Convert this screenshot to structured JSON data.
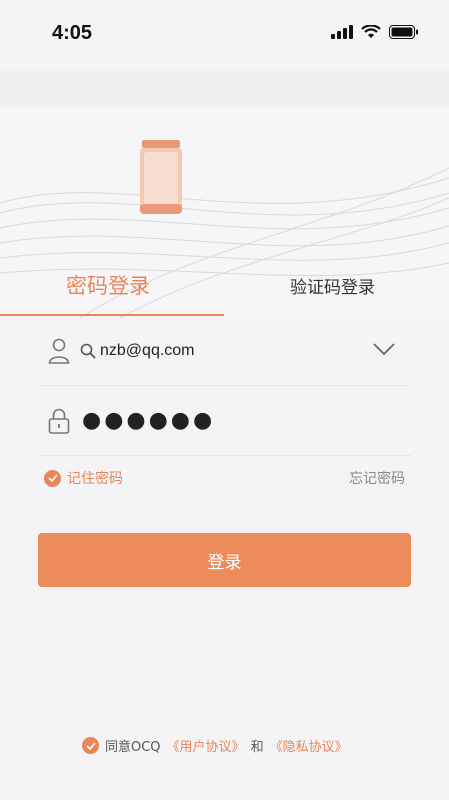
{
  "status_bar": {
    "time": "4:05"
  },
  "tabs": {
    "password_login": "密码登录",
    "code_login": "验证码登录"
  },
  "fields": {
    "email": "nzb@qq.com",
    "password_masked": "●●●●●●"
  },
  "options": {
    "remember": "记住密码",
    "forgot": "忘记密码"
  },
  "login_button": "登录",
  "agreement": {
    "prefix": "同意OCQ",
    "user_agreement": "《用户协议》",
    "and": "和",
    "privacy": "《隐私协议》"
  },
  "colors": {
    "accent": "#e8865a",
    "button": "#ee8b5b"
  },
  "icons": [
    "signal-icon",
    "wifi-icon",
    "battery-icon",
    "user-icon",
    "search-icon",
    "chevron-down-icon",
    "lock-icon",
    "check-icon"
  ]
}
